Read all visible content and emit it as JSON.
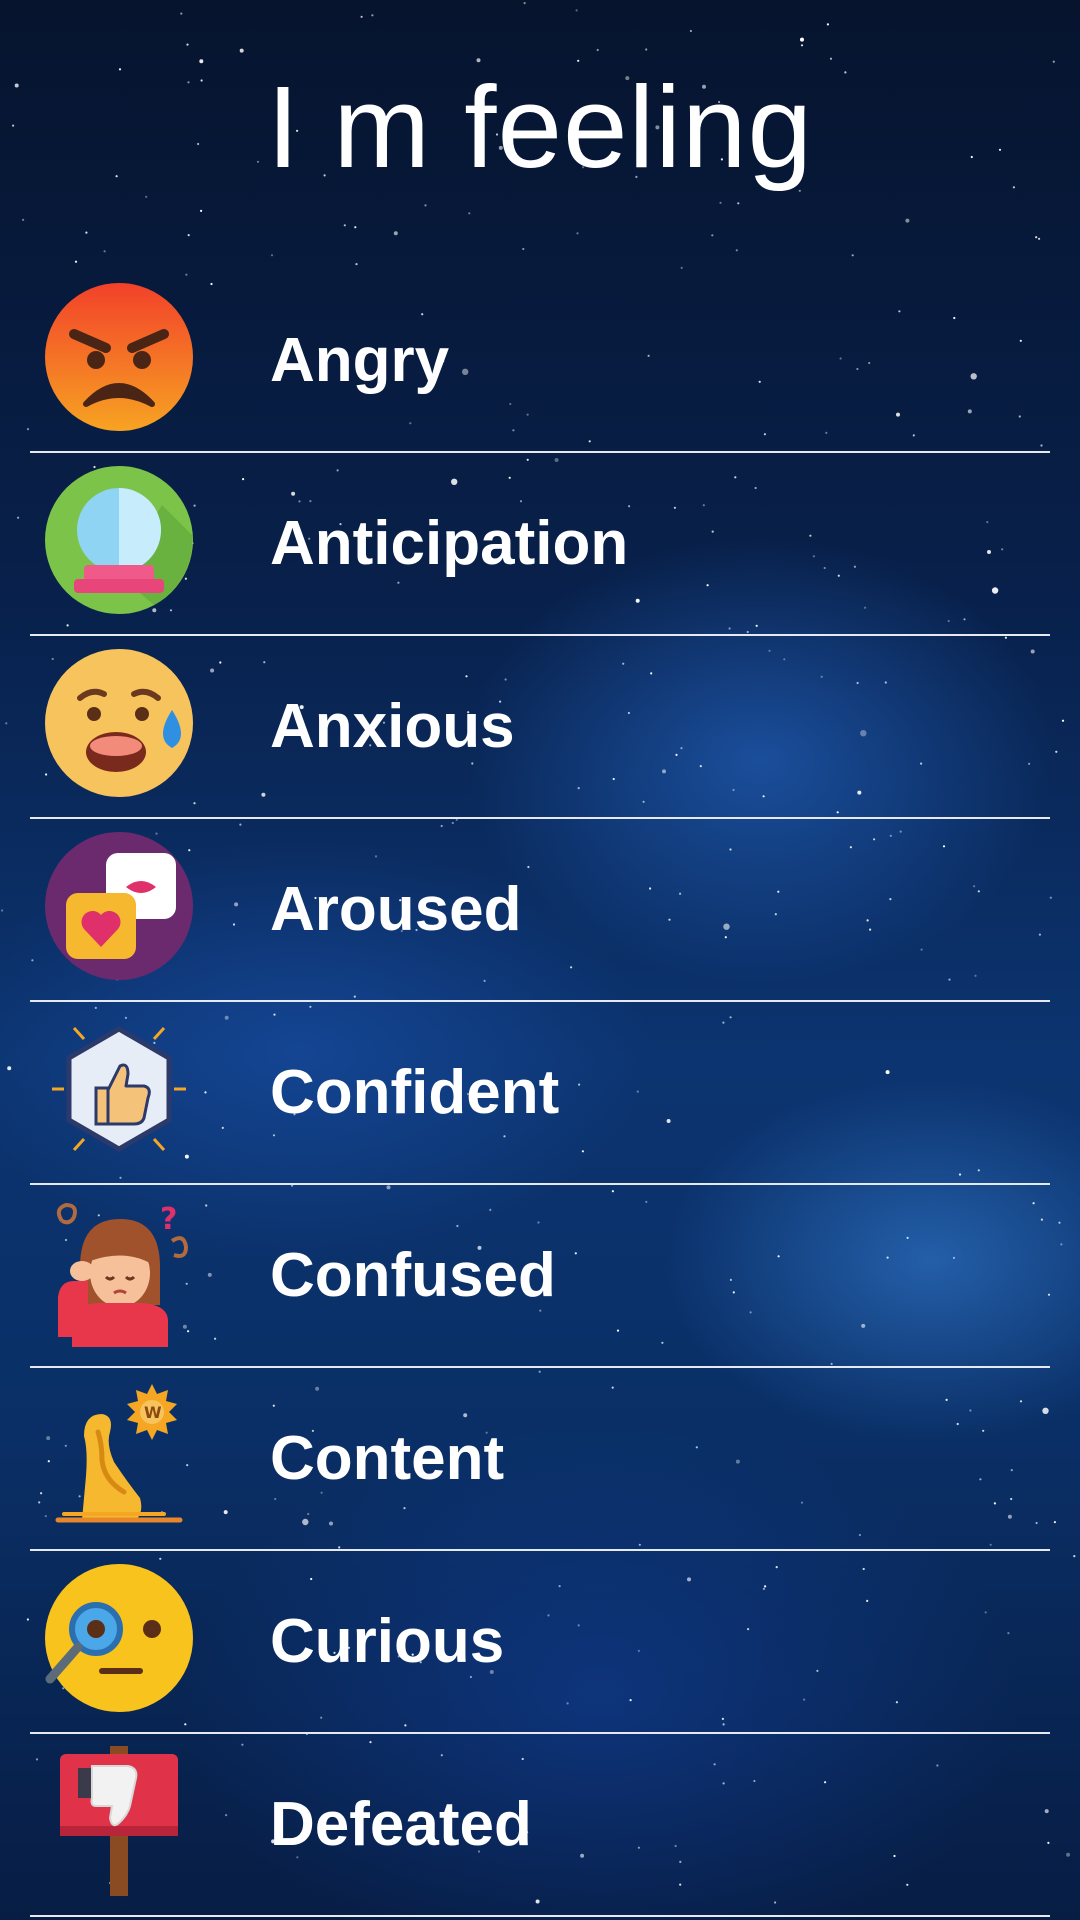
{
  "header": {
    "title": "I m feeling"
  },
  "feelings": [
    {
      "label": "Angry",
      "icon": "angry-face-icon"
    },
    {
      "label": "Anticipation",
      "icon": "crystal-ball-icon"
    },
    {
      "label": "Anxious",
      "icon": "anxious-face-icon"
    },
    {
      "label": "Aroused",
      "icon": "love-messages-icon"
    },
    {
      "label": "Confident",
      "icon": "thumbs-up-hexagon-icon"
    },
    {
      "label": "Confused",
      "icon": "confused-person-icon"
    },
    {
      "label": "Content",
      "icon": "content-statue-icon"
    },
    {
      "label": "Curious",
      "icon": "curious-face-magnifier-icon"
    },
    {
      "label": "Defeated",
      "icon": "thumbs-down-sign-icon"
    }
  ],
  "colors": {
    "background": "#0a2a5e",
    "text": "#ffffff",
    "divider": "#e6e9f0"
  }
}
